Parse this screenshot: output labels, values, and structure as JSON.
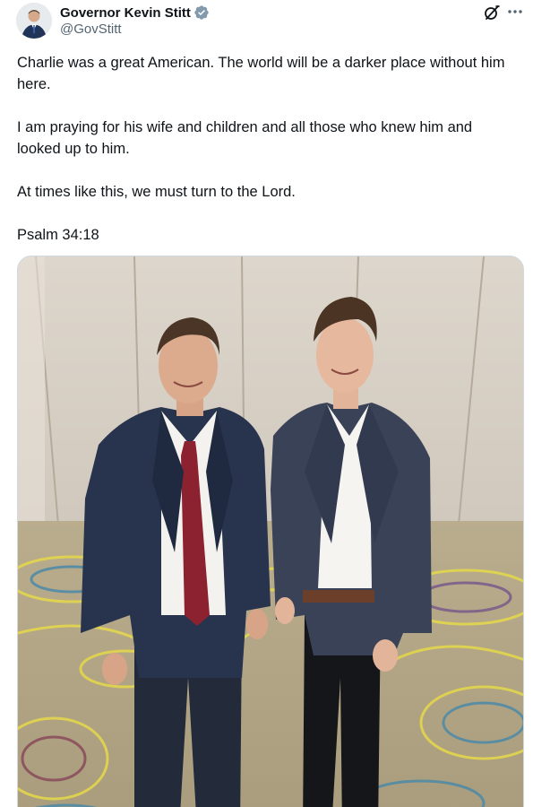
{
  "author": {
    "display_name": "Governor Kevin Stitt",
    "handle": "@GovStitt",
    "verified": true,
    "verified_color": "#829aab",
    "avatar_icon": "profile-photo"
  },
  "header_actions": {
    "grok_icon": "grok-icon",
    "more_icon": "more-dots-icon"
  },
  "post": {
    "paragraphs": [
      "Charlie was a great American. The world will be a darker place without him here.",
      "I am praying for his wife and children and all those who knew him and looked up to him.",
      "At times like this, we must turn to the Lord.",
      "Psalm 34:18"
    ]
  },
  "media": {
    "type": "photo",
    "alt_subject": "two-men-in-suits-standing-in-a-hotel-hallway"
  },
  "colors": {
    "text_primary": "#0f1419",
    "text_secondary": "#536471",
    "border": "#cfd9de"
  }
}
